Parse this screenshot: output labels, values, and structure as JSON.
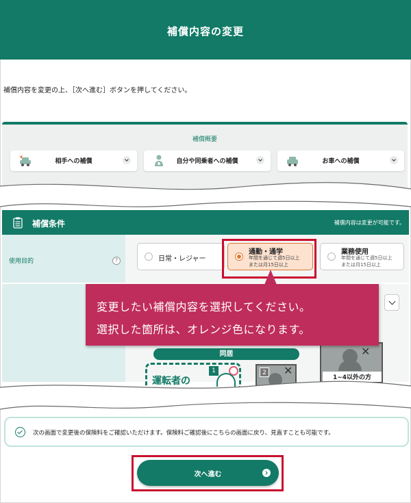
{
  "header": {
    "title": "補償内容の変更"
  },
  "instruction": "補償内容を変更の上、［次へ進む］ボタンを押してください。",
  "summary": {
    "title": "補償概要",
    "cards": [
      {
        "label": "相手への補償",
        "icon": "car-collision-icon"
      },
      {
        "label": "自分や同乗者への補償",
        "icon": "injured-person-icon"
      },
      {
        "label": "お車への補償",
        "icon": "car-icon"
      }
    ]
  },
  "conditions": {
    "title": "補償条件",
    "note": "補償内容は変更が可能です。",
    "usage": {
      "label": "使用目的",
      "help": "?",
      "options": [
        {
          "label": "日常・レジャー",
          "selected": false
        },
        {
          "label": "通勤・通学",
          "sub1": "年間を通じて週5日以上",
          "sub2": "または月15日以上",
          "selected": true
        },
        {
          "label": "業務使用",
          "sub1": "年間を通じて週5日以上",
          "sub2": "または月15日以上",
          "selected": false
        }
      ]
    },
    "illustration": {
      "doukyo": "同居",
      "driver": "運転者の",
      "badge1": "1",
      "badge2": "2",
      "other": "1~4以外の方"
    }
  },
  "callout": {
    "line1": "変更したい補償内容を選択してください。",
    "line2": "選択した箇所は、オレンジ色になります。"
  },
  "confirm_note": "次の画面で変更後の保険料をご確認いただけます。保険料ご確認後にこちらの画面に戻り、見直すことも可能です。",
  "next_button": "次へ進む",
  "colors": {
    "primary": "#127a66",
    "selected": "#e0762e",
    "callout": "#bf2d5c",
    "highlight": "#c8102e"
  }
}
